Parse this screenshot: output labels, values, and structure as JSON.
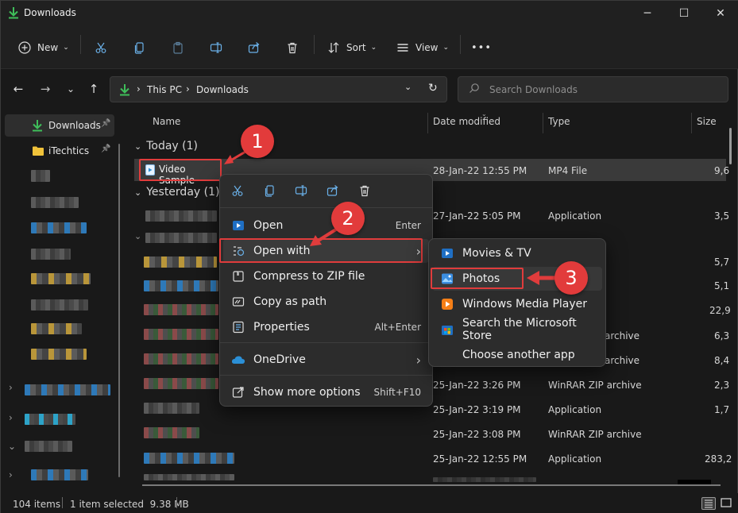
{
  "window": {
    "title": "Downloads",
    "minimize": "─",
    "maximize": "☐",
    "close": "✕"
  },
  "toolbar": {
    "new_label": "New",
    "sort_label": "Sort",
    "view_label": "View",
    "more_label": "•••"
  },
  "address": {
    "crumbs": [
      "This PC",
      "Downloads"
    ],
    "sep": "›"
  },
  "search": {
    "placeholder": "Search Downloads"
  },
  "sidebar": {
    "items": [
      {
        "label": "Downloads",
        "pin": "📌"
      },
      {
        "label": "iTechtics",
        "pin": "📌"
      }
    ]
  },
  "columns": {
    "name": "Name",
    "date": "Date modified",
    "type": "Type",
    "size": "Size"
  },
  "groups": {
    "today": "Today (1)",
    "yesterday": "Yesterday (1)"
  },
  "files": [
    {
      "name": "Video Sample",
      "date": "28-Jan-22 12:55 PM",
      "type": "MP4 File",
      "size": "9,6"
    },
    {
      "name": "",
      "date": "27-Jan-22 5:05 PM",
      "type": "Application",
      "size": "3,5"
    },
    {
      "name": "",
      "date": "",
      "type": "",
      "size": "5,7"
    },
    {
      "name": "",
      "date": "",
      "type": "",
      "size": "5,1"
    },
    {
      "name": "",
      "date": "",
      "type": "",
      "size": "22,9"
    },
    {
      "name": "",
      "date": "",
      "type": "archive",
      "size": "6,3"
    },
    {
      "name": "",
      "date": "",
      "type": "archive",
      "size": "8,4"
    },
    {
      "name": "",
      "date": "25-Jan-22 3:26 PM",
      "type": "WinRAR ZIP archive",
      "size": "2,3"
    },
    {
      "name": "",
      "date": "25-Jan-22 3:19 PM",
      "type": "Application",
      "size": "1,7"
    },
    {
      "name": "",
      "date": "25-Jan-22 3:08 PM",
      "type": "WinRAR ZIP archive",
      "size": ""
    },
    {
      "name": "",
      "date": "25-Jan-22 12:55 PM",
      "type": "Application",
      "size": "283,2"
    }
  ],
  "context_menu": {
    "open": {
      "label": "Open",
      "shortcut": "Enter"
    },
    "open_with": {
      "label": "Open with",
      "arrow": "›"
    },
    "compress": {
      "label": "Compress to ZIP file"
    },
    "copy_path": {
      "label": "Copy as path"
    },
    "properties": {
      "label": "Properties",
      "shortcut": "Alt+Enter"
    },
    "onedrive": {
      "label": "OneDrive",
      "arrow": "›"
    },
    "more": {
      "label": "Show more options",
      "shortcut": "Shift+F10"
    }
  },
  "submenu": {
    "items": [
      "Movies & TV",
      "Photos",
      "Windows Media Player",
      "Search the Microsoft Store",
      "Choose another app"
    ]
  },
  "steps": [
    "1",
    "2",
    "3"
  ],
  "status": {
    "count": "104 items",
    "selected": "1 item selected  9.38 MB"
  },
  "colors": {
    "accent": "#2b8fd6",
    "highlight": "#e03c3c",
    "download_green": "#3fbf5a",
    "folder_yellow": "#f0c23a"
  }
}
